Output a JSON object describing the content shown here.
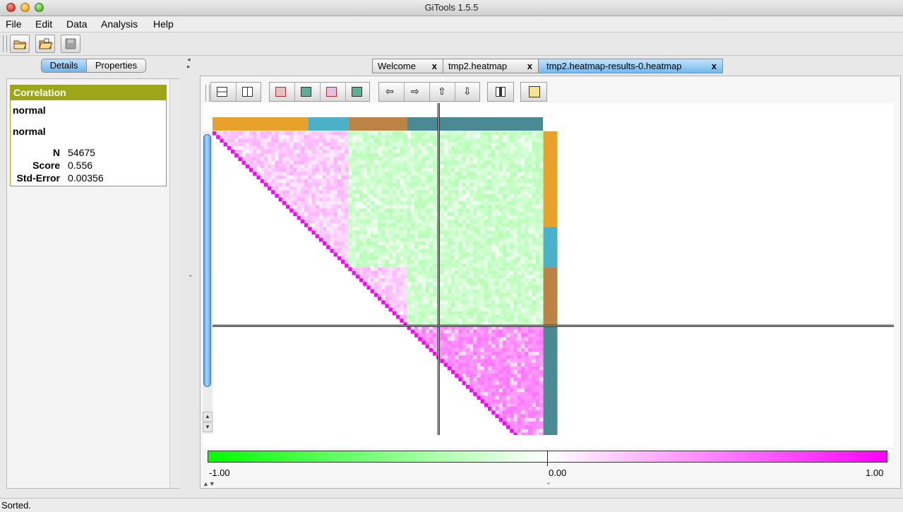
{
  "window": {
    "title": "GiTools 1.5.5"
  },
  "menu": [
    "File",
    "Edit",
    "Data",
    "Analysis",
    "Help"
  ],
  "left_tabs": {
    "details": "Details",
    "properties": "Properties"
  },
  "details_card": {
    "header": "Correlation",
    "label1": "normal",
    "label2": "normal",
    "stats": [
      {
        "key": "N",
        "value": "54675"
      },
      {
        "key": "Score",
        "value": "0.556"
      },
      {
        "key": "Std-Error",
        "value": "0.00356"
      }
    ]
  },
  "editor_tabs": [
    {
      "label": "Welcome",
      "close": "x"
    },
    {
      "label": "tmp2.heatmap",
      "close": "x"
    },
    {
      "label": "tmp2.heatmap-results-0.heatmap",
      "close": "x"
    }
  ],
  "heatmap": {
    "group_colors": [
      "#e8a22c",
      "#4bb1c8",
      "#bd8345",
      "#4a8a93"
    ],
    "low_color": "#00ff00",
    "mid_color": "#ffffff",
    "high_color": "#ff00ff"
  },
  "colorscale": {
    "min_label": "-1.00",
    "mid_label": "0.00",
    "max_label": "1.00"
  },
  "status": {
    "text": "Sorted."
  }
}
